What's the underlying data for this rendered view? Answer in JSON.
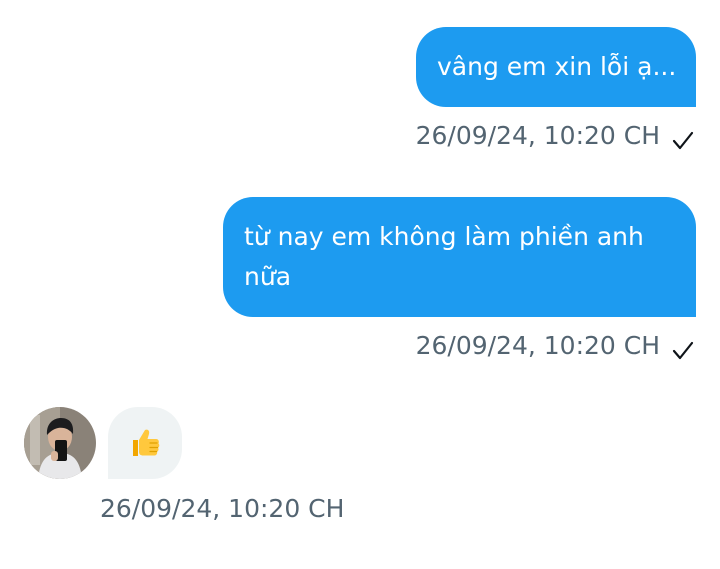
{
  "messages": [
    {
      "direction": "outgoing",
      "text": "vâng em xin lỗi ạ...",
      "timestamp": "26/09/24, 10:20 CH",
      "status_icon": "check-icon"
    },
    {
      "direction": "outgoing",
      "text": "từ nay em không làm phiền anh nữa",
      "timestamp": "26/09/24, 10:20 CH",
      "status_icon": "check-icon"
    },
    {
      "direction": "incoming",
      "text": "👍",
      "timestamp": "26/09/24, 10:20 CH",
      "avatar_icon": "avatar-photo"
    }
  ],
  "colors": {
    "outgoing_bubble": "#1d9bf0",
    "incoming_bubble": "#eff3f4",
    "timestamp_text": "#536471",
    "bubble_text": "#ffffff"
  }
}
